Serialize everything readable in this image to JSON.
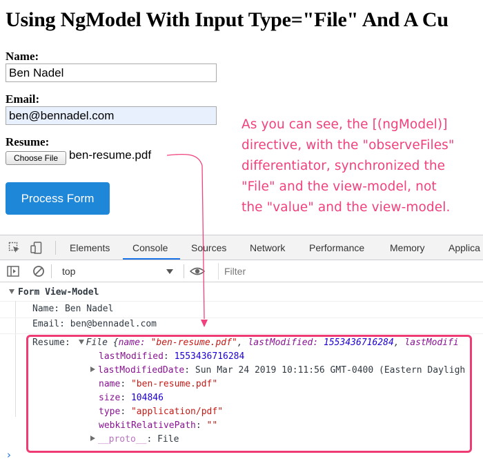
{
  "page": {
    "title": "Using NgModel With Input Type=\"File\" And A Cu",
    "name_label": "Name:",
    "name_value": "Ben Nadel",
    "email_label": "Email:",
    "email_value": "ben@bennadel.com",
    "resume_label": "Resume:",
    "choose_file_label": "Choose File",
    "file_name": "ben-resume.pdf",
    "submit_label": "Process Form"
  },
  "annotation": {
    "lines": [
      "As you can see, the [(ngModel)]",
      "directive, with the \"observeFiles\"",
      "differentiator, synchronized the",
      "\"File\" and the view-model, not",
      "the \"value\" and the view-model."
    ],
    "color": "#f0417e"
  },
  "devtools": {
    "tabs": [
      "Elements",
      "Console",
      "Sources",
      "Network",
      "Performance",
      "Memory",
      "Applica"
    ],
    "active_tab": "Console",
    "context": "top",
    "filter_placeholder": "Filter",
    "icons": [
      "inspect-element-icon",
      "device-toolbar-icon",
      "sidebar-toggle-icon",
      "clear-console-icon",
      "eye-icon"
    ],
    "console": {
      "group_title": "Form View-Model",
      "name_line": "Name: Ben Nadel",
      "email_line": "Email: ben@bennadel.com",
      "resume_key": "Resume:",
      "file_summary": {
        "prefix": "File {",
        "k1": "name:",
        "v1": "\"ben-resume.pdf\"",
        "sep1": ",",
        "k2": "lastModified:",
        "v2": "1553436716284",
        "sep2": ",",
        "k3": "lastModifi"
      },
      "props": [
        {
          "key": "lastModified",
          "value": "1553436716284",
          "type": "number",
          "expandable": false
        },
        {
          "key": "lastModifiedDate",
          "value": "Sun Mar 24 2019 10:11:56 GMT-0400 (Eastern Dayligh",
          "type": "plain",
          "expandable": true
        },
        {
          "key": "name",
          "value": "\"ben-resume.pdf\"",
          "type": "string",
          "expandable": false
        },
        {
          "key": "size",
          "value": "104846",
          "type": "number",
          "expandable": false
        },
        {
          "key": "type",
          "value": "\"application/pdf\"",
          "type": "string",
          "expandable": false
        },
        {
          "key": "webkitRelativePath",
          "value": "\"\"",
          "type": "string",
          "expandable": false
        },
        {
          "key": "__proto__",
          "value": "File",
          "type": "plain",
          "expandable": true
        }
      ],
      "prompt_symbol": "›"
    },
    "highlight_color": "#ee3b74"
  }
}
